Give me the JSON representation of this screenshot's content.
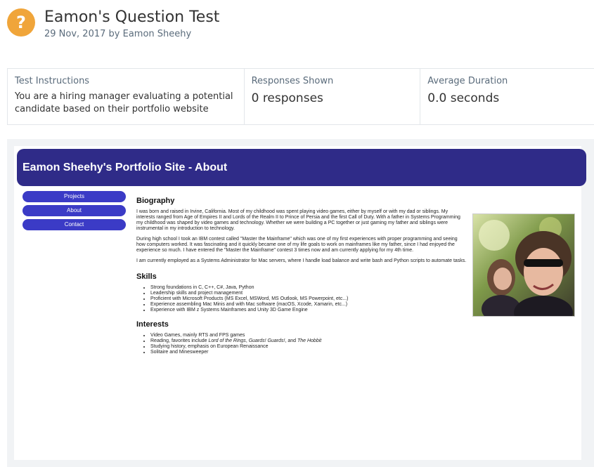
{
  "header": {
    "title": "Eamon's Question Test",
    "subtitle": "29 Nov, 2017 by Eamon Sheehy",
    "icon": "question-icon",
    "icon_color": "#f0a53a"
  },
  "stats": {
    "instructions_label": "Test Instructions",
    "instructions_value": "You are a hiring manager evaluating a potential candidate based on their portfolio website",
    "responses_label": "Responses Shown",
    "responses_value": "0 responses",
    "duration_label": "Average Duration",
    "duration_value": "0.0 seconds"
  },
  "site": {
    "banner": "Eamon Sheehy's Portfolio Site - About",
    "banner_color": "#2f2b88",
    "nav": [
      "Projects",
      "About",
      "Contact"
    ],
    "nav_color": "#3b3bc6",
    "biography_heading": "Biography",
    "bio_p1": "I was born and raised in Irvine, California. Most of my childhood was spent playing video games, either by myself or with my dad or siblings. My interests ranged from Age of Empires II and Lords of the Realm II to Prince of Persia and the first Call of Duty. With a father in Systems Programming my childhood was shaped by video games and technology. Whether we were building a PC together or just gaming my father and siblings were instrumental in my introduction to technology.",
    "bio_p2": "During high school I took an IBM contest called \"Master the Mainframe\" which was one of my first experiences with proper programming and seeing how computers worked. It was fascinating and it quickly became one of my life goals to work on mainframes like my father, since I had enjoyed the experience so much. I have entered the \"Master the Mainframe\" contest 3 times now and am currently applying for my 4th time.",
    "bio_p3": "I am currently employed as a Systems Administrator for Mac servers, where I handle load balance and write bash and Python scripts to automate tasks.",
    "skills_heading": "Skills",
    "skills": [
      "Strong foundations in C, C++, C#, Java, Python",
      "Leadership skills and project management",
      "Proficient with Microsoft Products (MS Excel, MSWord, MS Outlook, MS Powerpoint, etc...)",
      "Experience assembling Mac Minis and with Mac software (macOS, Xcode, Xamarin, etc...)",
      "Experience with IBM z Systems Mainframes and Unity 3D Game Engine"
    ],
    "interests_heading": "Interests",
    "interests_1": "Video Games, mainly RTS and FPS games",
    "interests_2_a": "Reading, favorites include ",
    "interests_2_b": "Lord of the Rings",
    "interests_2_c": ", ",
    "interests_2_d": "Guards! Guards!",
    "interests_2_e": ", and ",
    "interests_2_f": "The Hobbit",
    "interests_3": "Studying history, emphasis on European Renaissance",
    "interests_4": "Solitaire and Minesweeper"
  }
}
